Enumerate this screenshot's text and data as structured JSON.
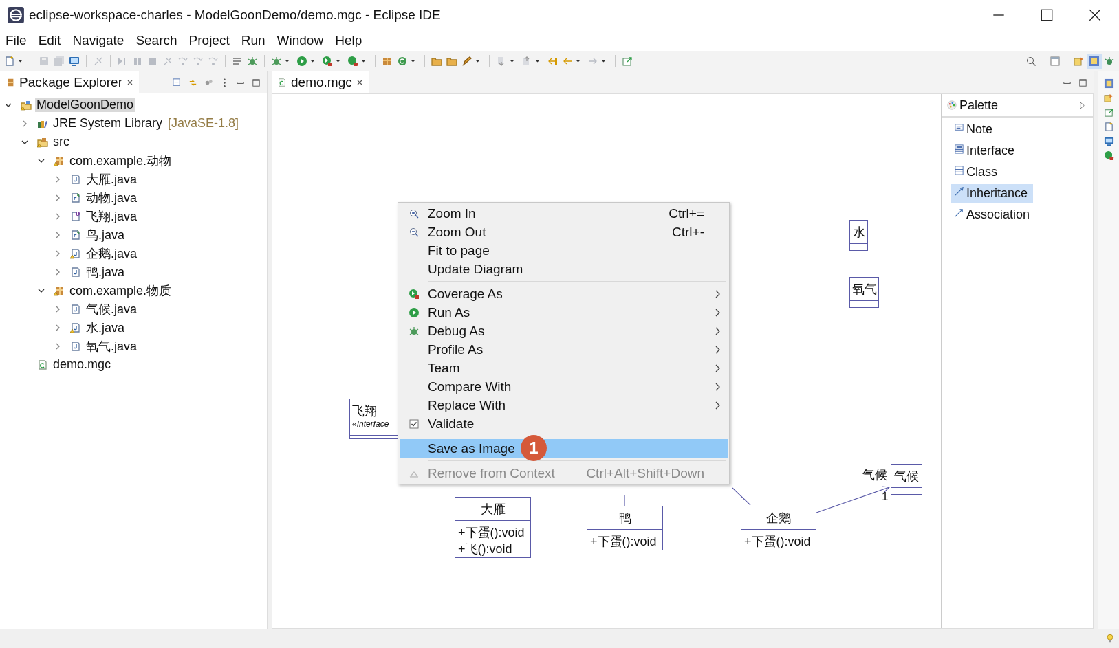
{
  "window": {
    "title": "eclipse-workspace-charles - ModelGoonDemo/demo.mgc - Eclipse IDE"
  },
  "menu_bar": [
    "File",
    "Edit",
    "Navigate",
    "Search",
    "Project",
    "Run",
    "Window",
    "Help"
  ],
  "package_explorer": {
    "title": "Package Explorer",
    "tree": [
      {
        "label": "ModelGoonDemo",
        "kind": "project",
        "warning": true,
        "expanded": true,
        "selected": true,
        "children": [
          {
            "label": "JRE System Library",
            "decoration": "[JavaSE-1.8]",
            "kind": "library",
            "warning": false,
            "expanded": false,
            "selected": false
          },
          {
            "label": "src",
            "kind": "source-folder",
            "warning": true,
            "expanded": true,
            "selected": false,
            "children": [
              {
                "label": "com.example.动物",
                "kind": "package",
                "warning": true,
                "expanded": true,
                "selected": false,
                "children": [
                  {
                    "label": "大雁.java",
                    "kind": "class",
                    "warning": false,
                    "expanded": false,
                    "selected": false
                  },
                  {
                    "label": "动物.java",
                    "kind": "abstract",
                    "warning": false,
                    "expanded": false,
                    "selected": false
                  },
                  {
                    "label": "飞翔.java",
                    "kind": "interface",
                    "warning": false,
                    "expanded": false,
                    "selected": false
                  },
                  {
                    "label": "鸟.java",
                    "kind": "abstract",
                    "warning": false,
                    "expanded": false,
                    "selected": false
                  },
                  {
                    "label": "企鹅.java",
                    "kind": "class",
                    "warning": true,
                    "expanded": false,
                    "selected": false
                  },
                  {
                    "label": "鸭.java",
                    "kind": "class",
                    "warning": false,
                    "expanded": false,
                    "selected": false
                  }
                ]
              },
              {
                "label": "com.example.物质",
                "kind": "package",
                "warning": true,
                "expanded": true,
                "selected": false,
                "children": [
                  {
                    "label": "气候.java",
                    "kind": "class",
                    "warning": false,
                    "expanded": false,
                    "selected": false
                  },
                  {
                    "label": "水.java",
                    "kind": "class",
                    "warning": true,
                    "expanded": false,
                    "selected": false
                  },
                  {
                    "label": "氧气.java",
                    "kind": "class",
                    "warning": false,
                    "expanded": false,
                    "selected": false
                  }
                ]
              }
            ]
          },
          {
            "label": "demo.mgc",
            "kind": "diagram",
            "warning": false,
            "selected": false
          }
        ]
      }
    ]
  },
  "editor": {
    "tab": "demo.mgc",
    "diagram": {
      "classes": [
        {
          "name": "水"
        },
        {
          "name": "氧气"
        },
        {
          "name": "飞翔",
          "stereotype": "«Interface"
        },
        {
          "name": "气候"
        },
        {
          "name": "大雁",
          "operations": [
            "+下蛋():void",
            "+飞():void"
          ]
        },
        {
          "name": "鸭",
          "operations": [
            "+下蛋():void"
          ]
        },
        {
          "name": "企鹅",
          "operations": [
            "+下蛋():void"
          ]
        }
      ],
      "association": {
        "role": "气候",
        "multiplicity": "1"
      }
    },
    "palette": {
      "title": "Palette",
      "items": [
        {
          "label": "Note",
          "kind": "note",
          "selected": false
        },
        {
          "label": "Interface",
          "kind": "interface",
          "selected": false
        },
        {
          "label": "Class",
          "kind": "class",
          "selected": false
        },
        {
          "label": "Inheritance",
          "kind": "inheritance",
          "selected": true
        },
        {
          "label": "Association",
          "kind": "association",
          "selected": false
        }
      ]
    }
  },
  "context_menu": {
    "groups": [
      [
        {
          "label": "Zoom In",
          "kind": "zoomin",
          "shortcut": "Ctrl+=",
          "submenu": false,
          "selected": false,
          "disabled": false
        },
        {
          "label": "Zoom Out",
          "kind": "zoomout",
          "shortcut": "Ctrl+-",
          "submenu": false,
          "selected": false,
          "disabled": false
        },
        {
          "label": "Fit to page",
          "kind": "plain",
          "submenu": false,
          "selected": false,
          "disabled": false
        },
        {
          "label": "Update Diagram",
          "kind": "plain",
          "submenu": false,
          "selected": false,
          "disabled": false
        }
      ],
      [
        {
          "label": "Coverage As",
          "kind": "coverage",
          "submenu": true,
          "selected": false,
          "disabled": false
        },
        {
          "label": "Run As",
          "kind": "run",
          "submenu": true,
          "selected": false,
          "disabled": false
        },
        {
          "label": "Debug As",
          "kind": "debug",
          "submenu": true,
          "selected": false,
          "disabled": false
        },
        {
          "label": "Profile As",
          "kind": "plain",
          "submenu": true,
          "selected": false,
          "disabled": false
        },
        {
          "label": "Team",
          "kind": "plain",
          "submenu": true,
          "selected": false,
          "disabled": false
        },
        {
          "label": "Compare With",
          "kind": "plain",
          "submenu": true,
          "selected": false,
          "disabled": false
        },
        {
          "label": "Replace With",
          "kind": "plain",
          "submenu": true,
          "selected": false,
          "disabled": false
        },
        {
          "label": "Validate",
          "kind": "check",
          "checked": true,
          "submenu": false,
          "selected": false,
          "disabled": false
        }
      ],
      [
        {
          "label": "Save as Image",
          "kind": "plain",
          "badge": "1",
          "submenu": false,
          "selected": true,
          "disabled": false
        }
      ],
      [
        {
          "label": "Remove from Context",
          "kind": "remove",
          "shortcut": "Ctrl+Alt+Shift+Down",
          "submenu": false,
          "selected": false,
          "disabled": true
        }
      ]
    ]
  }
}
